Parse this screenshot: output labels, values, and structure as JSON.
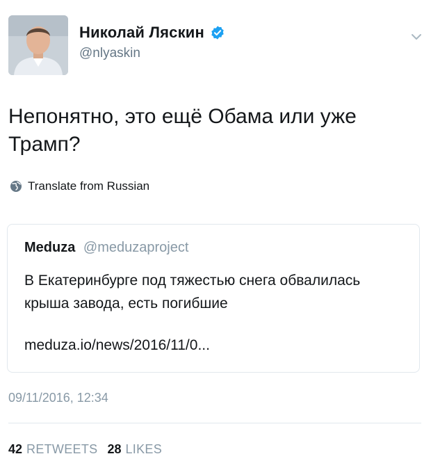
{
  "author": {
    "name": "Николай Ляскин",
    "handle": "@nlyaskin",
    "verified": true
  },
  "tweet": {
    "text": "Непонятно, это ещё Обама или уже Трамп?",
    "translate_label": "Translate from Russian",
    "timestamp": "09/11/2016, 12:34"
  },
  "quoted": {
    "name": "Meduza",
    "handle": "@meduzaproject",
    "text": "В Екатеринбурге под тяжестью снега обвалилась крыша завода, есть погибшие",
    "link": "meduza.io/news/2016/11/0..."
  },
  "stats": {
    "retweets_count": "42",
    "retweets_label": "RETWEETS",
    "likes_count": "28",
    "likes_label": "LIKES"
  },
  "colors": {
    "verified": "#1da1f2",
    "secondary_text": "#8899a6",
    "border": "#e1e8ed"
  },
  "icons": {
    "verified": "verified-badge-icon",
    "menu": "chevron-down-icon",
    "translate": "globe-icon"
  }
}
